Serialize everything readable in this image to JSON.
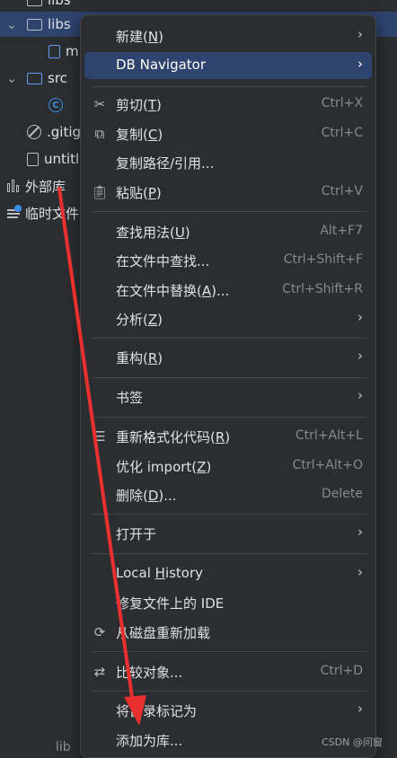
{
  "tree": {
    "items": [
      {
        "label": "libs"
      },
      {
        "label": "m"
      },
      {
        "label": "src"
      },
      {
        "label": ".gitig"
      },
      {
        "label": "untitl"
      },
      {
        "label": "外部库"
      },
      {
        "label": "临时文件"
      }
    ],
    "top_partial": "libs",
    "bottom_path": "lib"
  },
  "menu": {
    "items": [
      {
        "label": "新建(",
        "mn": "N",
        "end": ")",
        "shortcut": "",
        "submenu": true,
        "icon": ""
      },
      {
        "label": "DB Navigator",
        "mn": "",
        "end": "",
        "shortcut": "",
        "submenu": true,
        "icon": "",
        "active": true
      },
      {
        "label": "剪切(",
        "mn": "T",
        "end": ")",
        "shortcut": "Ctrl+X",
        "icon": "scissors-icon"
      },
      {
        "label": "复制(",
        "mn": "C",
        "end": ")",
        "shortcut": "Ctrl+C",
        "icon": "copy-icon"
      },
      {
        "label": "复制路径/引用...",
        "mn": "",
        "end": "",
        "shortcut": ""
      },
      {
        "label": "粘贴(",
        "mn": "P",
        "end": ")",
        "shortcut": "Ctrl+V",
        "icon": "paste-icon"
      },
      {
        "label": "查找用法(",
        "mn": "U",
        "end": ")",
        "shortcut": "Alt+F7"
      },
      {
        "label": "在文件中查找...",
        "mn": "",
        "end": "",
        "shortcut": "Ctrl+Shift+F"
      },
      {
        "label": "在文件中替换(",
        "mn": "A",
        "end": ")...",
        "shortcut": "Ctrl+Shift+R"
      },
      {
        "label": "分析(",
        "mn": "Z",
        "end": ")",
        "submenu": true
      },
      {
        "label": "重构(",
        "mn": "R",
        "end": ")",
        "submenu": true
      },
      {
        "label": "书签",
        "mn": "",
        "end": "",
        "submenu": true
      },
      {
        "label": "重新格式化代码(",
        "mn": "R",
        "end": ")",
        "shortcut": "Ctrl+Alt+L",
        "icon": "reformat-icon"
      },
      {
        "label": "优化 import(",
        "mn": "Z",
        "end": ")",
        "shortcut": "Ctrl+Alt+O"
      },
      {
        "label": "删除(",
        "mn": "D",
        "end": ")...",
        "shortcut": "Delete"
      },
      {
        "label": "打开于",
        "mn": "",
        "end": "",
        "submenu": true
      },
      {
        "label": "Local ",
        "mn": "H",
        "end": "istory",
        "submenu": true
      },
      {
        "label": "修复文件上的 IDE",
        "mn": "",
        "end": ""
      },
      {
        "label": "从磁盘重新加载",
        "mn": "",
        "end": "",
        "icon": "reload-icon"
      },
      {
        "label": "比较对象...",
        "mn": "",
        "end": "",
        "shortcut": "Ctrl+D",
        "icon": "compare-icon"
      },
      {
        "label": "将目录标记为",
        "mn": "",
        "end": "",
        "submenu": true
      },
      {
        "label": "添加为库...",
        "mn": "",
        "end": ""
      }
    ]
  },
  "watermark": "CSDN @问窗",
  "colors": {
    "accent": "#2e436e",
    "annotation": "#e8312f",
    "menu_bg": "#2b2d30"
  }
}
